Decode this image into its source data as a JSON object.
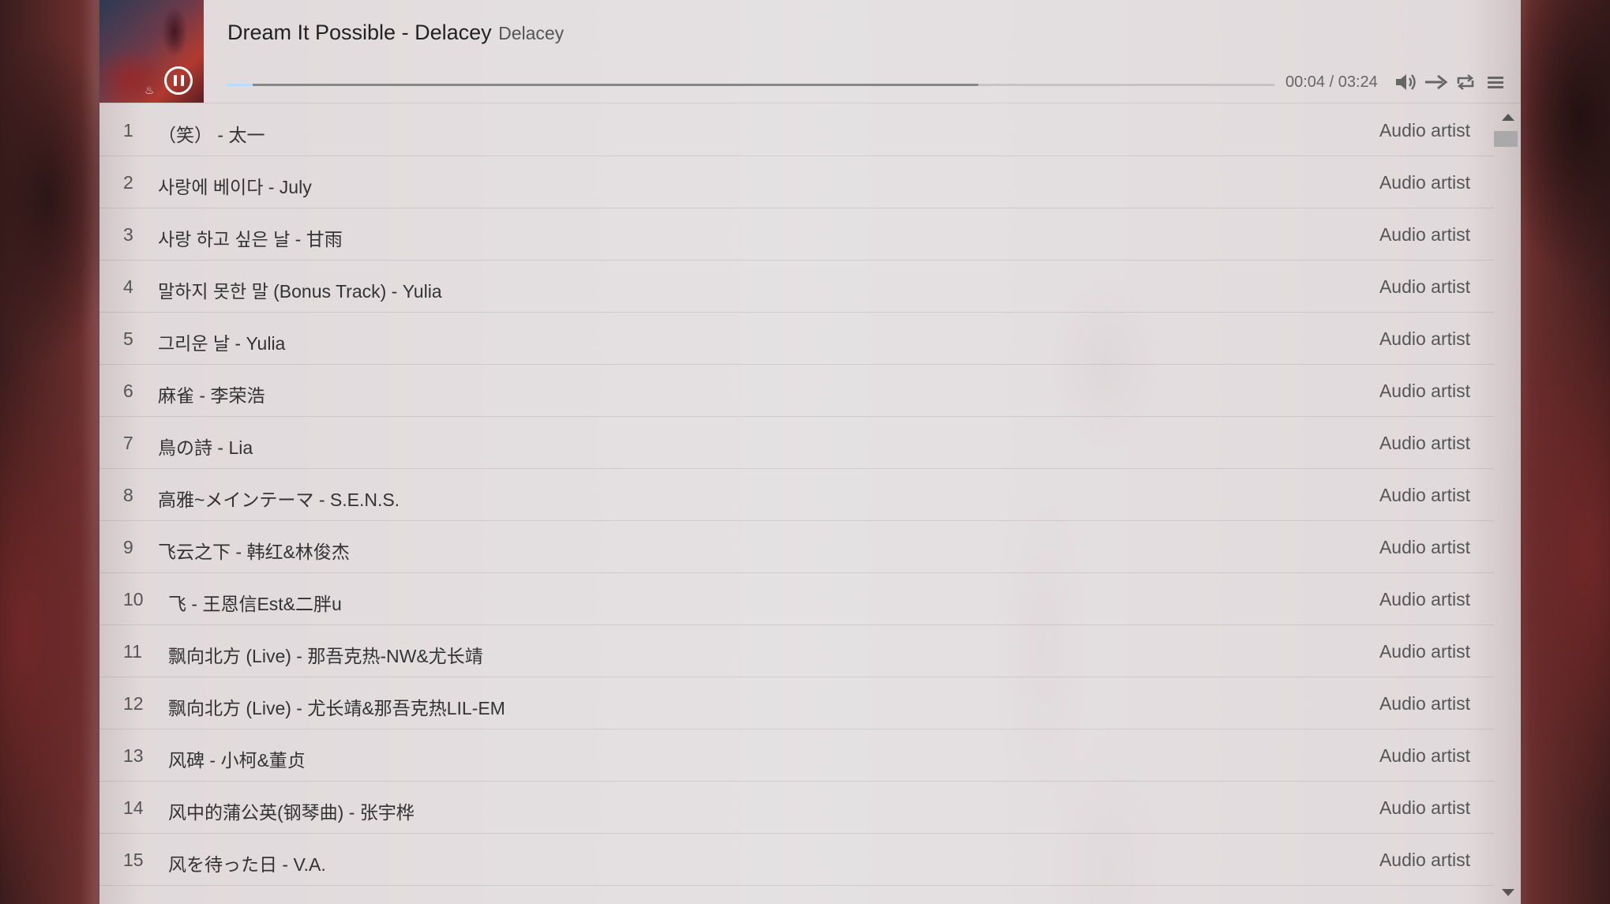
{
  "player": {
    "title": "Dream It Possible - Delacey",
    "artist": "Delacey",
    "time": "00:04 / 03:24",
    "progress_played_fraction": 0.024,
    "progress_loaded_fraction": 0.717
  },
  "controls": {
    "icons": [
      "volume-icon",
      "order-icon",
      "loop-icon",
      "menu-icon"
    ]
  },
  "playlist": [
    {
      "index": "1",
      "name": "（笑） - 太一",
      "artist": "Audio artist"
    },
    {
      "index": "2",
      "name": "사랑에 베이다 - July",
      "artist": "Audio artist"
    },
    {
      "index": "3",
      "name": "사랑 하고 싶은 날 - 甘雨",
      "artist": "Audio artist"
    },
    {
      "index": "4",
      "name": "말하지 못한 말 (Bonus Track) - Yulia",
      "artist": "Audio artist"
    },
    {
      "index": "5",
      "name": "그리운 날 - Yulia",
      "artist": "Audio artist"
    },
    {
      "index": "6",
      "name": "麻雀 - 李荣浩",
      "artist": "Audio artist"
    },
    {
      "index": "7",
      "name": "鳥の詩 - Lia",
      "artist": "Audio artist"
    },
    {
      "index": "8",
      "name": "高雅~メインテーマ - S.E.N.S.",
      "artist": "Audio artist"
    },
    {
      "index": "9",
      "name": "飞云之下 - 韩红&林俊杰",
      "artist": "Audio artist"
    },
    {
      "index": "10",
      "name": "飞 - 王恩信Est&二胖u",
      "artist": "Audio artist"
    },
    {
      "index": "11",
      "name": "飘向北方 (Live) - 那吾克热-NW&尤长靖",
      "artist": "Audio artist"
    },
    {
      "index": "12",
      "name": "飘向北方 (Live) - 尤长靖&那吾克热LIL-EM",
      "artist": "Audio artist"
    },
    {
      "index": "13",
      "name": "风碑 - 小柯&董贞",
      "artist": "Audio artist"
    },
    {
      "index": "14",
      "name": "风中的蒲公英(钢琴曲) - 张宇桦",
      "artist": "Audio artist"
    },
    {
      "index": "15",
      "name": "风を待った日 - V.A.",
      "artist": "Audio artist"
    }
  ]
}
